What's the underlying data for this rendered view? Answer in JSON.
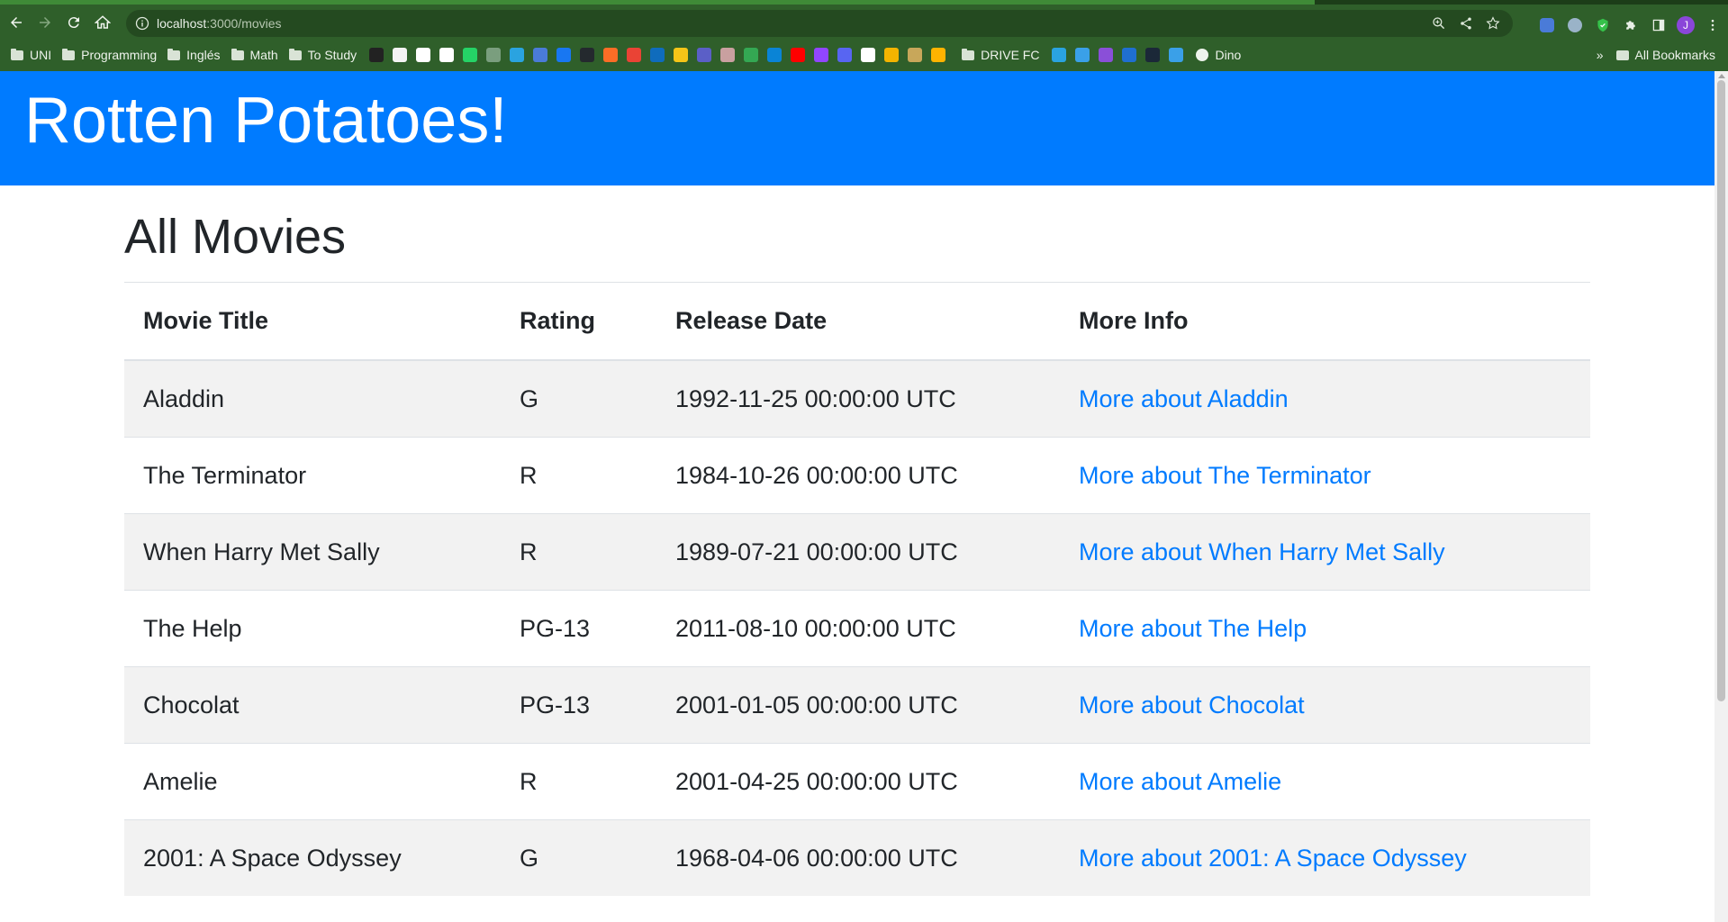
{
  "browser": {
    "url_host": "localhost",
    "url_path": ":3000/movies",
    "avatar_initial": "J",
    "bookmarks_folders": [
      "UNI",
      "Programming",
      "Inglés",
      "Math",
      "To Study"
    ],
    "bookmark_drive_fc": "DRIVE FC",
    "bookmark_dino": "Dino",
    "all_bookmarks": "All Bookmarks",
    "overflow_chevron": "»",
    "bookmark_icon_colors": [
      "#222222",
      "#f4f4f4",
      "#ffffff",
      "#ffffff",
      "#25d366",
      "#7a9e7e",
      "#2aa3e0",
      "#4a7bd8",
      "#1877f2",
      "#24292e",
      "#fc6d26",
      "#ea4335",
      "#0f6cbd",
      "#f5c518",
      "#5b5fc7",
      "#c9a0a0",
      "#34a853",
      "#0a84d6",
      "#ff0000",
      "#9146ff",
      "#5865f2",
      "#ffffff",
      "#f4b400",
      "#c8a75a",
      "#ffb300"
    ],
    "bookmark_icon_colors_2": [
      "#2aa3e0",
      "#3aa0e8",
      "#8a4fd8",
      "#1f6fd1",
      "#1b2838",
      "#3aa0e8"
    ]
  },
  "site": {
    "brand": "Rotten Potatoes!",
    "header_color": "#007bff",
    "link_color": "#007bff"
  },
  "main": {
    "heading": "All Movies",
    "columns": [
      "Movie Title",
      "Rating",
      "Release Date",
      "More Info"
    ],
    "movies": [
      {
        "title": "Aladdin",
        "rating": "G",
        "release_date": "1992-11-25 00:00:00 UTC",
        "link": "More about Aladdin"
      },
      {
        "title": "The Terminator",
        "rating": "R",
        "release_date": "1984-10-26 00:00:00 UTC",
        "link": "More about The Terminator"
      },
      {
        "title": "When Harry Met Sally",
        "rating": "R",
        "release_date": "1989-07-21 00:00:00 UTC",
        "link": "More about When Harry Met Sally"
      },
      {
        "title": "The Help",
        "rating": "PG-13",
        "release_date": "2011-08-10 00:00:00 UTC",
        "link": "More about The Help"
      },
      {
        "title": "Chocolat",
        "rating": "PG-13",
        "release_date": "2001-01-05 00:00:00 UTC",
        "link": "More about Chocolat"
      },
      {
        "title": "Amelie",
        "rating": "R",
        "release_date": "2001-04-25 00:00:00 UTC",
        "link": "More about Amelie"
      },
      {
        "title": "2001: A Space Odyssey",
        "rating": "G",
        "release_date": "1968-04-06 00:00:00 UTC",
        "link": "More about 2001: A Space Odyssey"
      }
    ]
  }
}
